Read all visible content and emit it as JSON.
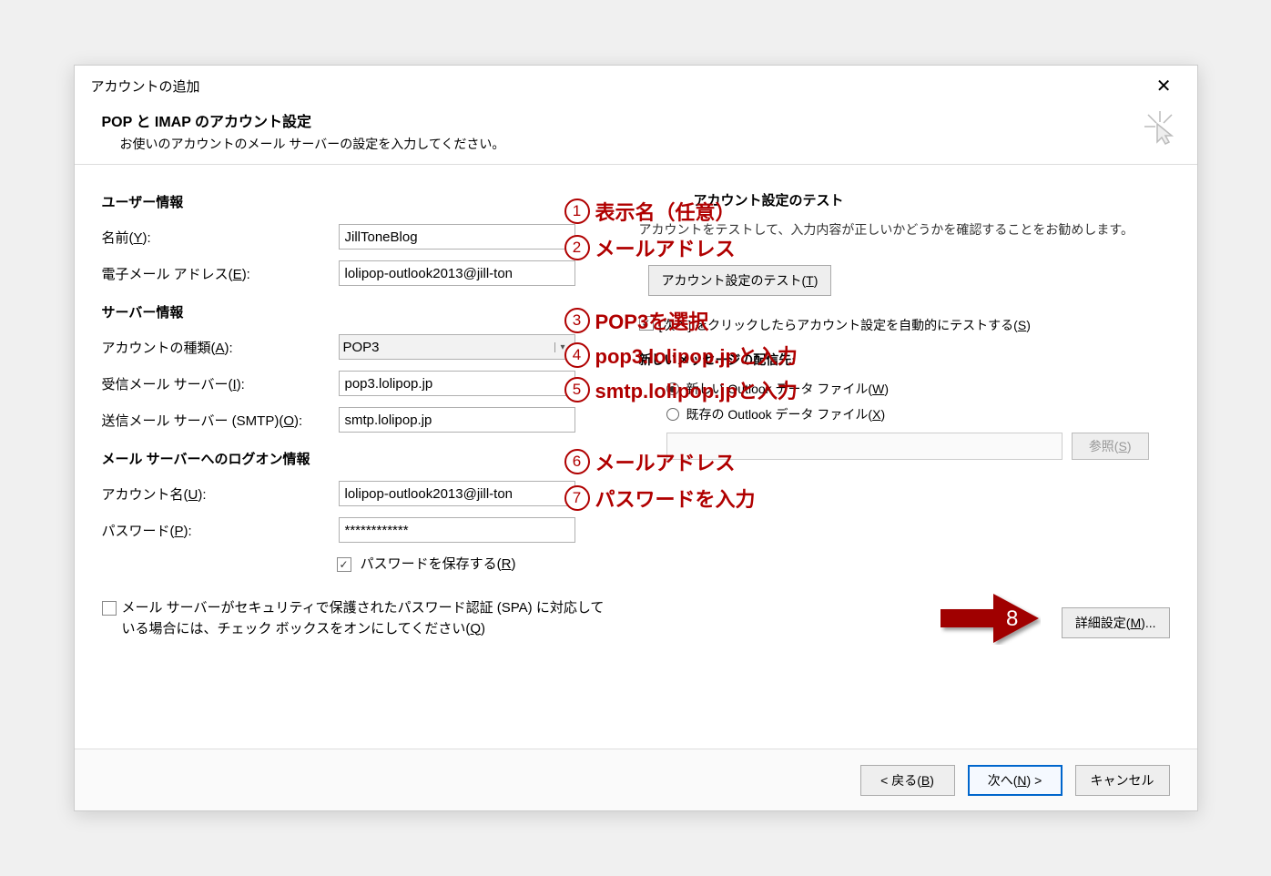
{
  "dialog": {
    "title": "アカウントの追加",
    "header_title": "POP と IMAP のアカウント設定",
    "header_sub": "お使いのアカウントのメール サーバーの設定を入力してください。"
  },
  "sections": {
    "user_info": "ユーザー情報",
    "server_info": "サーバー情報",
    "logon_info": "メール サーバーへのログオン情報"
  },
  "labels": {
    "name": "名前(Y):",
    "email": "電子メール アドレス(E):",
    "account_type": "アカウントの種類(A):",
    "incoming": "受信メール サーバー(I):",
    "outgoing": "送信メール サーバー (SMTP)(O):",
    "account_name": "アカウント名(U):",
    "password": "パスワード(P):",
    "save_password": "パスワードを保存する(R)",
    "spa": "メール サーバーがセキュリティで保護されたパスワード認証 (SPA) に対応している場合には、チェック ボックスをオンにしてください(Q)"
  },
  "values": {
    "name": "JillToneBlog",
    "email": "lolipop-outlook2013@jill-ton",
    "account_type": "POP3",
    "incoming": "pop3.lolipop.jp",
    "outgoing": "smtp.lolipop.jp",
    "account_name": "lolipop-outlook2013@jill-ton",
    "password": "************"
  },
  "right": {
    "test_head": "アカウント設定のテスト",
    "test_text": "アカウントをテストして、入力内容が正しいかどうかを確認することをお勧めします。",
    "test_btn": "アカウント設定のテスト(T)",
    "auto_test": "[次へ] をクリックしたらアカウント設定を自動的にテストする(S)",
    "delivery_head": "新しいメッセージの配信先:",
    "new_file": "新しい Outlook データ ファイル(W)",
    "existing_file": "既存の Outlook データ ファイル(X)",
    "browse": "参照(S)",
    "more": "詳細設定(M)..."
  },
  "footer": {
    "back": "< 戻る(B)",
    "next": "次へ(N) >",
    "cancel": "キャンセル"
  },
  "annotations": {
    "a1": "表示名（任意）",
    "a2": "メールアドレス",
    "a3": "POP3を選択",
    "a4": "pop3.lolipop.jpと入力",
    "a5": "smtp.lolipop.jpと入力",
    "a6": "メールアドレス",
    "a7": "パスワードを入力"
  }
}
